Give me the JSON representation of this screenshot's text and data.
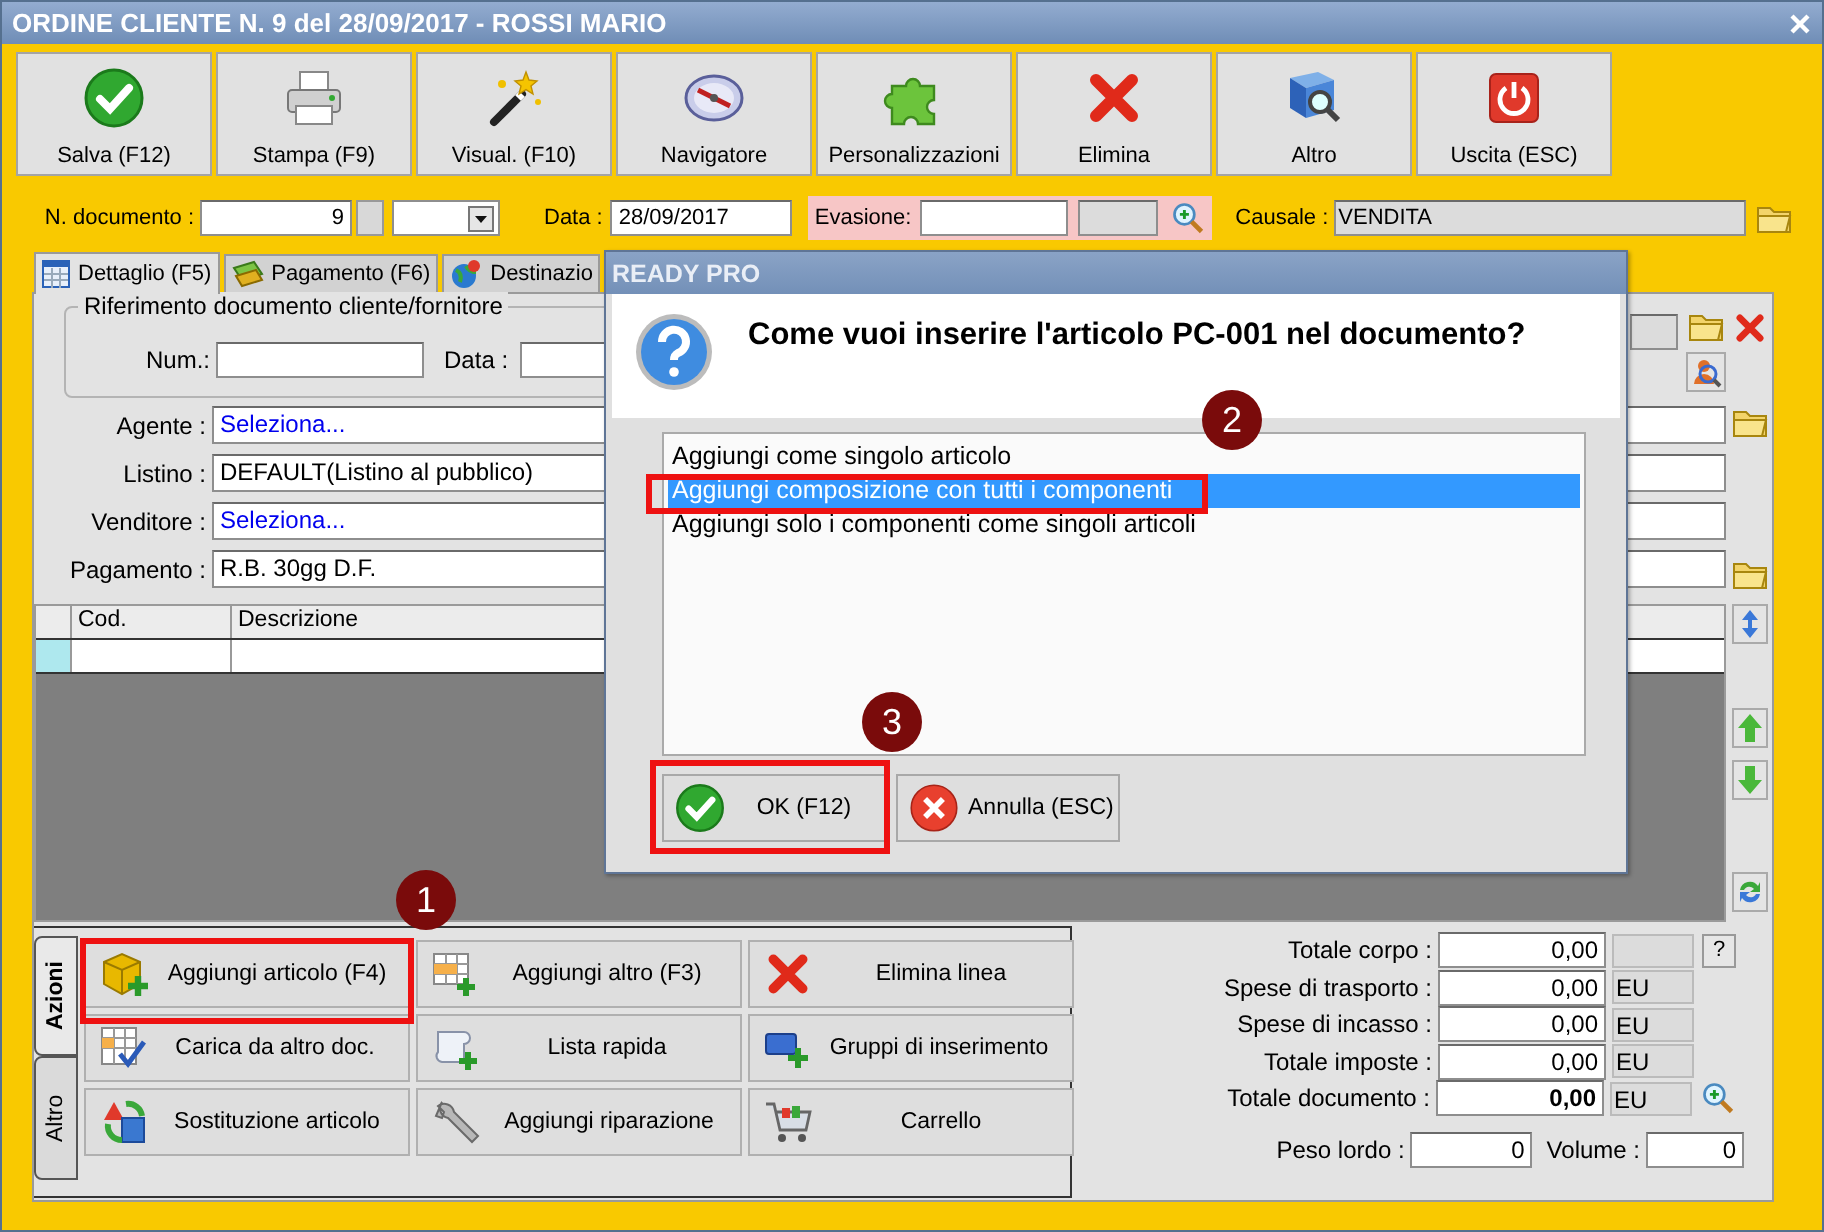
{
  "window": {
    "title": "ORDINE CLIENTE N. 9 del 28/09/2017 - ROSSI MARIO"
  },
  "toolbar": [
    {
      "label": "Salva (F12)"
    },
    {
      "label": "Stampa (F9)"
    },
    {
      "label": "Visual. (F10)"
    },
    {
      "label": "Navigatore"
    },
    {
      "label": "Personalizzazioni"
    },
    {
      "label": "Elimina"
    },
    {
      "label": "Altro"
    },
    {
      "label": "Uscita (ESC)"
    }
  ],
  "header": {
    "number": {
      "label": "N. documento :",
      "value": "9"
    },
    "date": {
      "label": "Data :",
      "value": "28/09/2017"
    },
    "evasione": {
      "label": "Evasione:"
    },
    "causale": {
      "label": "Causale :",
      "value": "VENDITA"
    }
  },
  "tabs": [
    {
      "label": "Dettaglio (F5)",
      "selected": true
    },
    {
      "label": "Pagamento (F6)",
      "selected": false
    },
    {
      "label": "Destinazio",
      "selected": false
    }
  ],
  "reference_group": {
    "title": "Riferimento documento cliente/fornitore",
    "num_label": "Num.:",
    "date_label": "Data :"
  },
  "form_rows": [
    {
      "label": "Agente :",
      "value": "Seleziona...",
      "kind": "link"
    },
    {
      "label": "Listino :",
      "value": "DEFAULT(Listino al pubblico)",
      "kind": "text"
    },
    {
      "label": "Venditore :",
      "value": "Seleziona...",
      "kind": "link"
    },
    {
      "label": "Pagamento :",
      "value": "R.B. 30gg D.F.",
      "kind": "text"
    }
  ],
  "grid": {
    "columns": [
      "Cod.",
      "Descrizione"
    ]
  },
  "dialog": {
    "title": "READY PRO",
    "question": "Come vuoi inserire l'articolo PC-001 nel documento?",
    "options": [
      {
        "label": "Aggiungi come singolo articolo",
        "selected": false
      },
      {
        "label": "Aggiungi composizione con tutti i componenti",
        "selected": true
      },
      {
        "label": "Aggiungi solo i componenti come singoli articoli",
        "selected": false
      }
    ],
    "buttons": [
      {
        "label": "OK (F12)"
      },
      {
        "label": "Annulla (ESC)"
      }
    ]
  },
  "action_tabs": [
    {
      "label": "Azioni",
      "selected": true
    },
    {
      "label": "Altro",
      "selected": false
    }
  ],
  "actions": [
    {
      "label": "Aggiungi articolo (F4)"
    },
    {
      "label": "Aggiungi altro (F3)"
    },
    {
      "label": "Elimina linea"
    },
    {
      "label": "Carica da altro doc."
    },
    {
      "label": "Lista rapida"
    },
    {
      "label": "Gruppi di inserimento"
    },
    {
      "label": "Sostituzione articolo"
    },
    {
      "label": "Aggiungi riparazione"
    },
    {
      "label": "Carrello"
    }
  ],
  "totals": [
    {
      "label": "Totale corpo :",
      "value": "0,00",
      "button": "?",
      "emphasized": false
    },
    {
      "label": "Spese di trasporto :",
      "value": "0,00",
      "unit": "EU",
      "emphasized": false
    },
    {
      "label": "Spese di incasso :",
      "value": "0,00",
      "unit": "EU",
      "emphasized": false
    },
    {
      "label": "Totale imposte :",
      "value": "0,00",
      "unit": "EU",
      "emphasized": false
    },
    {
      "label": "Totale documento :",
      "value": "0,00",
      "unit": "EU",
      "emphasized": true
    }
  ],
  "measures": [
    {
      "label": "Peso lordo :",
      "value": "0"
    },
    {
      "label": "Volume :",
      "value": "0"
    }
  ],
  "annotations": [
    {
      "label": "1"
    },
    {
      "label": "2"
    },
    {
      "label": "3"
    }
  ]
}
